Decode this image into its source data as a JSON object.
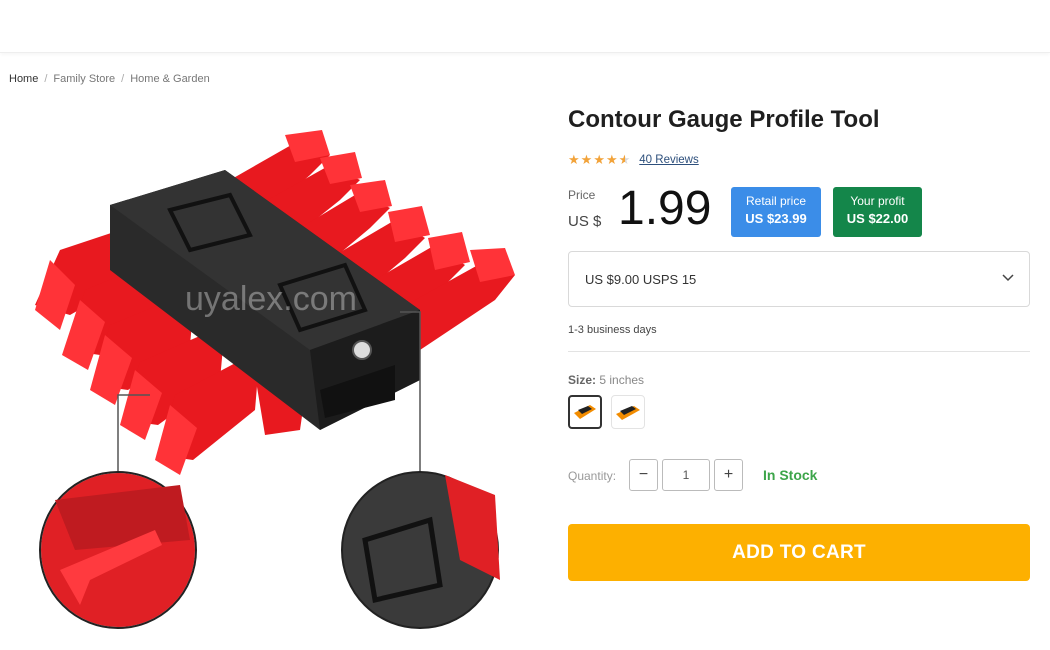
{
  "breadcrumb": [
    {
      "label": "Home"
    },
    {
      "label": "Family Store"
    },
    {
      "label": "Home & Garden"
    }
  ],
  "product": {
    "title": "Contour Gauge Profile Tool",
    "rating": 4.5,
    "reviews_label": "40 Reviews"
  },
  "price": {
    "label": "Price",
    "currency": "US $",
    "amount": "1.99"
  },
  "retail": {
    "label": "Retail price",
    "value": "US $23.99",
    "color": "#3b8de8"
  },
  "profit": {
    "label": "Your profit",
    "value": "US $22.00",
    "color": "#14864a"
  },
  "shipping": {
    "selected": "US $9.00 USPS 15",
    "delivery": "1-3 business days"
  },
  "size": {
    "label": "Size:",
    "value": "5 inches"
  },
  "quantity": {
    "label": "Quantity:",
    "value": "1",
    "minus": "−",
    "plus": "+"
  },
  "stock_status": "In Stock",
  "add_to_cart": "ADD TO CART",
  "colors": {
    "accent": "#fdb000",
    "stock": "#3da54a",
    "product_red": "#f0242a"
  },
  "gallery": {
    "watermark": "uyalex.com"
  }
}
